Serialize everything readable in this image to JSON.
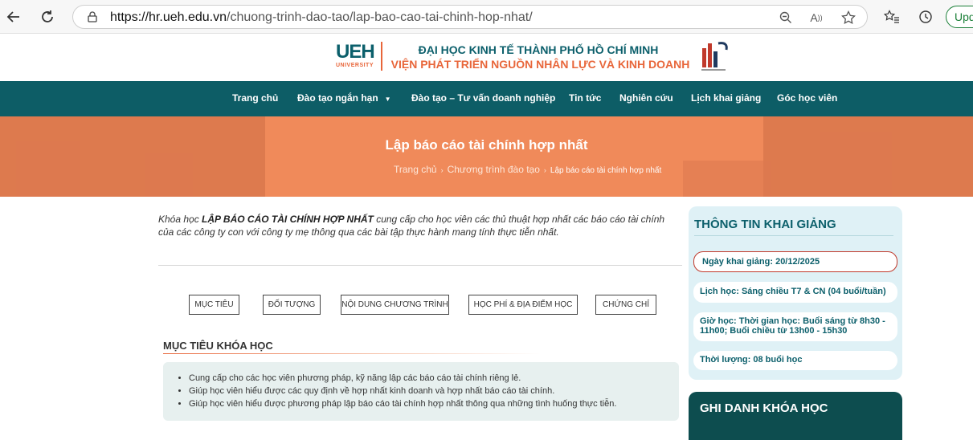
{
  "browser": {
    "url_host": "https://hr.ueh.edu.vn",
    "url_path": "/chuong-trinh-dao-tao/lap-bao-cao-tai-chinh-hop-nhat/",
    "update_label": "Upd"
  },
  "header": {
    "logo_text": "UEH",
    "logo_sub": "UNIVERSITY",
    "institution_line1": "ĐẠI HỌC KINH TẾ THÀNH PHỐ HỒ CHÍ MINH",
    "institution_line2": "VIỆN PHÁT TRIỂN NGUỒN NHÂN LỰC VÀ KINH DOANH"
  },
  "nav": {
    "items": [
      "Trang chủ",
      "Đào tạo ngắn hạn",
      "Đào tạo – Tư vấn doanh nghiệp",
      "Tin tức",
      "Nghiên cứu",
      "Lịch khai giảng",
      "Góc học viên"
    ],
    "dropdown_icon": "caret-down-icon"
  },
  "banner": {
    "title": "Lập báo cáo tài chính hợp nhất",
    "breadcrumb": [
      "Trang chủ",
      "Chương trình đào tạo",
      "Lập báo cáo tài chính hợp nhất"
    ]
  },
  "intro": {
    "prefix": "Khóa học ",
    "course_name": "LẬP BÁO CÁO TÀI CHÍNH HỢP NHẤT",
    "suffix": " cung cấp cho học viên các thủ thuật hợp nhất các báo cáo tài chính của các công ty con với công ty mẹ thông qua các bài tập thực hành mang tính thực tiễn nhất."
  },
  "tabs": [
    "MỤC TIÊU",
    "ĐỐI TƯỢNG",
    "NỘI DUNG CHƯƠNG TRÌNH",
    "HỌC PHÍ & ĐỊA ĐIỂM HỌC",
    "CHỨNG CHỈ"
  ],
  "goals": {
    "title": "MỤC TIÊU KHÓA HỌC",
    "items": [
      "Cung cấp cho các học viên phương pháp, kỹ năng lập các báo cáo tài chính riêng lẻ.",
      "Giúp học viên hiểu được các quy định về hợp nhất kinh doanh và hợp nhất báo cáo tài chính.",
      "Giúp học viên hiểu được phương pháp lập báo cáo tài chính hợp nhất thông qua những tình huống thực tiễn."
    ]
  },
  "sidebar": {
    "title": "THÔNG TIN KHAI GIẢNG",
    "start_date": "Ngày khai giảng: 20/12/2025",
    "schedule": "Lịch học: Sáng chiều T7 & CN (04 buổi/tuần)",
    "time_line1": "Giờ học: Thời gian học: Buổi sáng từ 8h30 -",
    "time_line2": "11h00; Buổi chiều từ 13h00 - 15h30",
    "duration": "Thời lượng: 08 buổi học",
    "enroll_title": "GHI DANH KHÓA HỌC"
  },
  "colors": {
    "teal": "#0d5d66",
    "orange": "#e8663a",
    "banner": "#f08a5a",
    "side_panel": "#dff1f6"
  }
}
